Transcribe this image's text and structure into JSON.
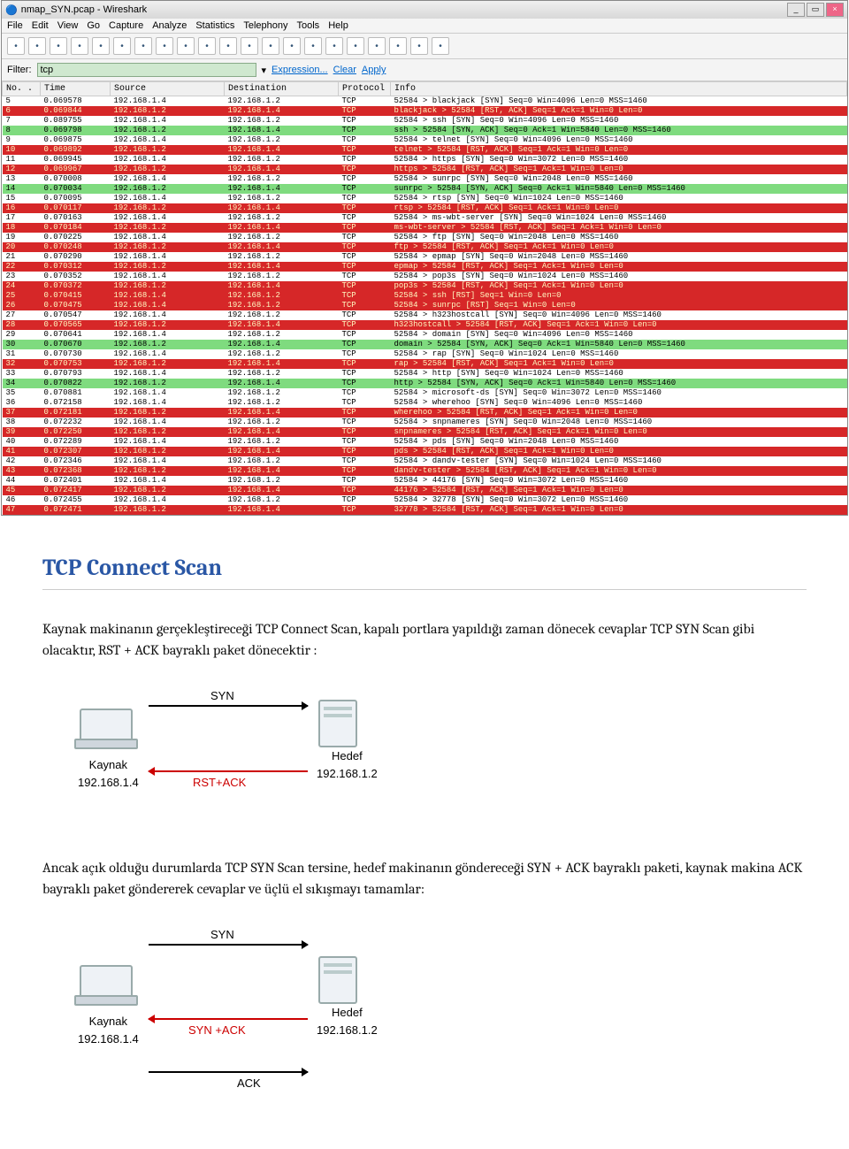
{
  "window": {
    "title": "nmap_SYN.pcap - Wireshark"
  },
  "menu": [
    "File",
    "Edit",
    "View",
    "Go",
    "Capture",
    "Analyze",
    "Statistics",
    "Telephony",
    "Tools",
    "Help"
  ],
  "filter": {
    "label": "Filter:",
    "value": "tcp",
    "expression": "Expression...",
    "clear": "Clear",
    "apply": "Apply"
  },
  "columns": [
    "No. .",
    "Time",
    "Source",
    "Destination",
    "Protocol",
    "Info"
  ],
  "rows": [
    {
      "c": "plain",
      "no": "5",
      "time": "0.069578",
      "src": "192.168.1.4",
      "dst": "192.168.1.2",
      "proto": "TCP",
      "info": "52584 > blackjack [SYN] Seq=0 Win=4096 Len=0 MSS=1460"
    },
    {
      "c": "rst",
      "no": "6",
      "time": "0.069844",
      "src": "192.168.1.2",
      "dst": "192.168.1.4",
      "proto": "TCP",
      "info": "blackjack > 52584 [RST, ACK] Seq=1 Ack=1 Win=0 Len=0"
    },
    {
      "c": "plain",
      "no": "7",
      "time": "0.089755",
      "src": "192.168.1.4",
      "dst": "192.168.1.2",
      "proto": "TCP",
      "info": "52584 > ssh [SYN] Seq=0 Win=4096 Len=0 MSS=1460"
    },
    {
      "c": "synack",
      "no": "8",
      "time": "0.069798",
      "src": "192.168.1.2",
      "dst": "192.168.1.4",
      "proto": "TCP",
      "info": "ssh > 52584 [SYN, ACK] Seq=0 Ack=1 Win=5840 Len=0 MSS=1460"
    },
    {
      "c": "plain",
      "no": "9",
      "time": "0.069875",
      "src": "192.168.1.4",
      "dst": "192.168.1.2",
      "proto": "TCP",
      "info": "52584 > telnet [SYN] Seq=0 Win=4096 Len=0 MSS=1460"
    },
    {
      "c": "rst",
      "no": "10",
      "time": "0.069892",
      "src": "192.168.1.2",
      "dst": "192.168.1.4",
      "proto": "TCP",
      "info": "telnet > 52584 [RST, ACK] Seq=1 Ack=1 Win=0 Len=0"
    },
    {
      "c": "plain",
      "no": "11",
      "time": "0.069945",
      "src": "192.168.1.4",
      "dst": "192.168.1.2",
      "proto": "TCP",
      "info": "52584 > https [SYN] Seq=0 Win=3072 Len=0 MSS=1460"
    },
    {
      "c": "rst",
      "no": "12",
      "time": "0.069967",
      "src": "192.168.1.2",
      "dst": "192.168.1.4",
      "proto": "TCP",
      "info": "https > 52584 [RST, ACK] Seq=1 Ack=1 Win=0 Len=0"
    },
    {
      "c": "plain",
      "no": "13",
      "time": "0.070008",
      "src": "192.168.1.4",
      "dst": "192.168.1.2",
      "proto": "TCP",
      "info": "52584 > sunrpc [SYN] Seq=0 Win=2048 Len=0 MSS=1460"
    },
    {
      "c": "synack",
      "no": "14",
      "time": "0.070034",
      "src": "192.168.1.2",
      "dst": "192.168.1.4",
      "proto": "TCP",
      "info": "sunrpc > 52584 [SYN, ACK] Seq=0 Ack=1 Win=5840 Len=0 MSS=1460"
    },
    {
      "c": "plain",
      "no": "15",
      "time": "0.070095",
      "src": "192.168.1.4",
      "dst": "192.168.1.2",
      "proto": "TCP",
      "info": "52584 > rtsp [SYN] Seq=0 Win=1024 Len=0 MSS=1460"
    },
    {
      "c": "rst",
      "no": "16",
      "time": "0.070117",
      "src": "192.168.1.2",
      "dst": "192.168.1.4",
      "proto": "TCP",
      "info": "rtsp > 52584 [RST, ACK] Seq=1 Ack=1 Win=0 Len=0"
    },
    {
      "c": "plain",
      "no": "17",
      "time": "0.070163",
      "src": "192.168.1.4",
      "dst": "192.168.1.2",
      "proto": "TCP",
      "info": "52584 > ms-wbt-server [SYN] Seq=0 Win=1024 Len=0 MSS=1460"
    },
    {
      "c": "rst",
      "no": "18",
      "time": "0.070184",
      "src": "192.168.1.2",
      "dst": "192.168.1.4",
      "proto": "TCP",
      "info": "ms-wbt-server > 52584 [RST, ACK] Seq=1 Ack=1 Win=0 Len=0"
    },
    {
      "c": "plain",
      "no": "19",
      "time": "0.070225",
      "src": "192.168.1.4",
      "dst": "192.168.1.2",
      "proto": "TCP",
      "info": "52584 > ftp [SYN] Seq=0 Win=2048 Len=0 MSS=1460"
    },
    {
      "c": "rst",
      "no": "20",
      "time": "0.070248",
      "src": "192.168.1.2",
      "dst": "192.168.1.4",
      "proto": "TCP",
      "info": "ftp > 52584 [RST, ACK] Seq=1 Ack=1 Win=0 Len=0"
    },
    {
      "c": "plain",
      "no": "21",
      "time": "0.070290",
      "src": "192.168.1.4",
      "dst": "192.168.1.2",
      "proto": "TCP",
      "info": "52584 > epmap [SYN] Seq=0 Win=2048 Len=0 MSS=1460"
    },
    {
      "c": "rst",
      "no": "22",
      "time": "0.070312",
      "src": "192.168.1.2",
      "dst": "192.168.1.4",
      "proto": "TCP",
      "info": "epmap > 52584 [RST, ACK] Seq=1 Ack=1 Win=0 Len=0"
    },
    {
      "c": "plain",
      "no": "23",
      "time": "0.070352",
      "src": "192.168.1.4",
      "dst": "192.168.1.2",
      "proto": "TCP",
      "info": "52584 > pop3s [SYN] Seq=0 Win=1024 Len=0 MSS=1460"
    },
    {
      "c": "rst",
      "no": "24",
      "time": "0.070372",
      "src": "192.168.1.2",
      "dst": "192.168.1.4",
      "proto": "TCP",
      "info": "pop3s > 52584 [RST, ACK] Seq=1 Ack=1 Win=0 Len=0"
    },
    {
      "c": "rst",
      "no": "25",
      "time": "0.070415",
      "src": "192.168.1.4",
      "dst": "192.168.1.2",
      "proto": "TCP",
      "info": "52584 > ssh [RST] Seq=1 Win=0 Len=0"
    },
    {
      "c": "rst",
      "no": "26",
      "time": "0.070475",
      "src": "192.168.1.4",
      "dst": "192.168.1.2",
      "proto": "TCP",
      "info": "52584 > sunrpc [RST] Seq=1 Win=0 Len=0"
    },
    {
      "c": "plain",
      "no": "27",
      "time": "0.070547",
      "src": "192.168.1.4",
      "dst": "192.168.1.2",
      "proto": "TCP",
      "info": "52584 > h323hostcall [SYN] Seq=0 Win=4096 Len=0 MSS=1460"
    },
    {
      "c": "rst",
      "no": "28",
      "time": "0.070565",
      "src": "192.168.1.2",
      "dst": "192.168.1.4",
      "proto": "TCP",
      "info": "h323hostcall > 52584 [RST, ACK] Seq=1 Ack=1 Win=0 Len=0"
    },
    {
      "c": "plain",
      "no": "29",
      "time": "0.070641",
      "src": "192.168.1.4",
      "dst": "192.168.1.2",
      "proto": "TCP",
      "info": "52584 > domain [SYN] Seq=0 Win=4096 Len=0 MSS=1460"
    },
    {
      "c": "synack",
      "no": "30",
      "time": "0.070670",
      "src": "192.168.1.2",
      "dst": "192.168.1.4",
      "proto": "TCP",
      "info": "domain > 52584 [SYN, ACK] Seq=0 Ack=1 Win=5840 Len=0 MSS=1460"
    },
    {
      "c": "plain",
      "no": "31",
      "time": "0.070730",
      "src": "192.168.1.4",
      "dst": "192.168.1.2",
      "proto": "TCP",
      "info": "52584 > rap [SYN] Seq=0 Win=1024 Len=0 MSS=1460"
    },
    {
      "c": "rst",
      "no": "32",
      "time": "0.070753",
      "src": "192.168.1.2",
      "dst": "192.168.1.4",
      "proto": "TCP",
      "info": "rap > 52584 [RST, ACK] Seq=1 Ack=1 Win=0 Len=0"
    },
    {
      "c": "plain",
      "no": "33",
      "time": "0.070793",
      "src": "192.168.1.4",
      "dst": "192.168.1.2",
      "proto": "TCP",
      "info": "52584 > http [SYN] Seq=0 Win=1024 Len=0 MSS=1460"
    },
    {
      "c": "synack",
      "no": "34",
      "time": "0.070822",
      "src": "192.168.1.2",
      "dst": "192.168.1.4",
      "proto": "TCP",
      "info": "http > 52584 [SYN, ACK] Seq=0 Ack=1 Win=5840 Len=0 MSS=1460"
    },
    {
      "c": "plain",
      "no": "35",
      "time": "0.070881",
      "src": "192.168.1.4",
      "dst": "192.168.1.2",
      "proto": "TCP",
      "info": "52584 > microsoft-ds [SYN] Seq=0 Win=3072 Len=0 MSS=1460"
    },
    {
      "c": "plain",
      "no": "36",
      "time": "0.072158",
      "src": "192.168.1.4",
      "dst": "192.168.1.2",
      "proto": "TCP",
      "info": "52584 > wherehoo [SYN] Seq=0 Win=4096 Len=0 MSS=1460"
    },
    {
      "c": "rst",
      "no": "37",
      "time": "0.072181",
      "src": "192.168.1.2",
      "dst": "192.168.1.4",
      "proto": "TCP",
      "info": "wherehoo > 52584 [RST, ACK] Seq=1 Ack=1 Win=0 Len=0"
    },
    {
      "c": "plain",
      "no": "38",
      "time": "0.072232",
      "src": "192.168.1.4",
      "dst": "192.168.1.2",
      "proto": "TCP",
      "info": "52584 > snpnameres [SYN] Seq=0 Win=2048 Len=0 MSS=1460"
    },
    {
      "c": "rst",
      "no": "39",
      "time": "0.072250",
      "src": "192.168.1.2",
      "dst": "192.168.1.4",
      "proto": "TCP",
      "info": "snpnameres > 52584 [RST, ACK] Seq=1 Ack=1 Win=0 Len=0"
    },
    {
      "c": "plain",
      "no": "40",
      "time": "0.072289",
      "src": "192.168.1.4",
      "dst": "192.168.1.2",
      "proto": "TCP",
      "info": "52584 > pds [SYN] Seq=0 Win=2048 Len=0 MSS=1460"
    },
    {
      "c": "rst",
      "no": "41",
      "time": "0.072307",
      "src": "192.168.1.2",
      "dst": "192.168.1.4",
      "proto": "TCP",
      "info": "pds > 52584 [RST, ACK] Seq=1 Ack=1 Win=0 Len=0"
    },
    {
      "c": "plain",
      "no": "42",
      "time": "0.072346",
      "src": "192.168.1.4",
      "dst": "192.168.1.2",
      "proto": "TCP",
      "info": "52584 > dandv-tester [SYN] Seq=0 Win=1024 Len=0 MSS=1460"
    },
    {
      "c": "rst",
      "no": "43",
      "time": "0.072368",
      "src": "192.168.1.2",
      "dst": "192.168.1.4",
      "proto": "TCP",
      "info": "dandv-tester > 52584 [RST, ACK] Seq=1 Ack=1 Win=0 Len=0"
    },
    {
      "c": "plain",
      "no": "44",
      "time": "0.072401",
      "src": "192.168.1.4",
      "dst": "192.168.1.2",
      "proto": "TCP",
      "info": "52584 > 44176 [SYN] Seq=0 Win=3072 Len=0 MSS=1460"
    },
    {
      "c": "rst",
      "no": "45",
      "time": "0.072417",
      "src": "192.168.1.2",
      "dst": "192.168.1.4",
      "proto": "TCP",
      "info": "44176 > 52584 [RST, ACK] Seq=1 Ack=1 Win=0 Len=0"
    },
    {
      "c": "plain",
      "no": "46",
      "time": "0.072455",
      "src": "192.168.1.4",
      "dst": "192.168.1.2",
      "proto": "TCP",
      "info": "52584 > 32778 [SYN] Seq=0 Win=3072 Len=0 MSS=1460"
    },
    {
      "c": "rst",
      "no": "47",
      "time": "0.072471",
      "src": "192.168.1.2",
      "dst": "192.168.1.4",
      "proto": "TCP",
      "info": "32778 > 52584 [RST, ACK] Seq=1 Ack=1 Win=0 Len=0"
    }
  ],
  "doc": {
    "heading": "TCP Connect Scan",
    "p1": "Kaynak makinanın gerçekleştireceği TCP Connect Scan, kapalı portlara yapıldığı zaman dönecek cevaplar TCP SYN Scan gibi olacaktır, RST + ACK bayraklı paket dönecektir :",
    "p2": "Ancak açık olduğu durumlarda TCP SYN Scan tersine, hedef makinanın göndereceği SYN + ACK bayraklı paketi, kaynak makina ACK bayraklı paket göndererek cevaplar ve üçlü el sıkışmayı tamamlar:",
    "d1": {
      "src": "Kaynak",
      "srcip": "192.168.1.4",
      "dst": "Hedef",
      "dstip": "192.168.1.2",
      "a1": "SYN",
      "a2": "RST+ACK"
    },
    "d2": {
      "src": "Kaynak",
      "srcip": "192.168.1.4",
      "dst": "Hedef",
      "dstip": "192.168.1.2",
      "a1": "SYN",
      "a2": "SYN +ACK",
      "a3": "ACK"
    }
  }
}
